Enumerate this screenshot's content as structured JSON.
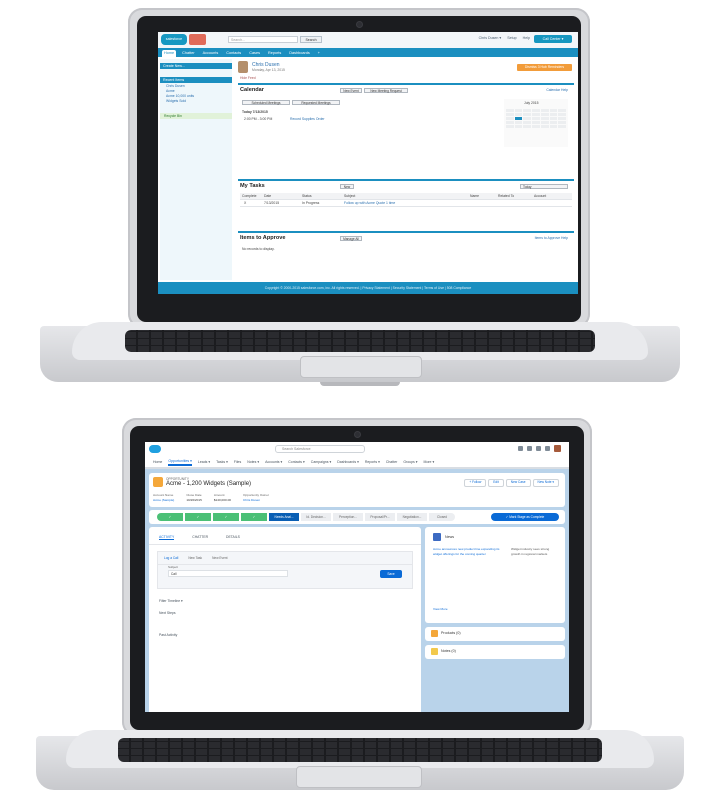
{
  "laptop_top": {
    "screen_app": "classic",
    "header": {
      "logo_text": "salesforce",
      "search_placeholder": "Search...",
      "search_button": "Search",
      "user_menu": "Chris Dusen ▾",
      "help_link": "Setup",
      "help_link_2": "Help",
      "app_switcher": "Call Center ▾"
    },
    "tabs": [
      "Home",
      "Chatter",
      "Accounts",
      "Contacts",
      "Cases",
      "Reports",
      "Dashboards",
      "+"
    ],
    "sidebar": {
      "create_new": "Create New...",
      "recent_items_title": "Recent Items",
      "recent_items": [
        "Chris Dusen",
        "Acme",
        "Acme 10,000 units",
        "Widgets Sold"
      ],
      "recycle_bin": "Recycle Bin"
    },
    "main": {
      "user_name": "Chris Dusen",
      "date": "Monday, Apr 13, 2015",
      "hide_feed": "Hide Feed",
      "orange_button": "Dismiss 3 Hub Reminders",
      "calendar_title": "Calendar",
      "calendar_new_event": "New Event",
      "calendar_new_meeting": "New Meeting Request",
      "calendar_link": "Calendar Help",
      "scheduled_meetings": "Scheduled Meetings",
      "requested_meetings": "Requested Meetings",
      "today_label": "Today 7/13/2015",
      "event_time": "2:00 PM - 3:00 PM",
      "event_link": "Record Supplies Order",
      "month_label": "July 2015",
      "tasks_title": "My Tasks",
      "tasks_new": "New",
      "tasks_filter": "Today",
      "tasks_columns": [
        "Complete",
        "Date",
        "Status",
        "Subject",
        "Name",
        "Related To",
        "Account"
      ],
      "tasks_row": [
        "X",
        "7/13/2015",
        "In Progress",
        "Follow up with Acme Quote 1 time",
        "",
        "",
        ""
      ],
      "approve_title": "Items to Approve",
      "approve_manage": "Manage All",
      "approve_link": "Items to Approve Help",
      "approve_empty": "No records to display.",
      "footer": "Copyright © 2000-2015 salesforce.com, inc. All rights reserved. | Privacy Statement | Security Statement | Terms of Use | 508 Compliance"
    }
  },
  "laptop_bottom": {
    "screen_app": "lightning",
    "header": {
      "search_placeholder": "Search Salesforce"
    },
    "nav": [
      "Home",
      "Opportunities ▾",
      "Leads ▾",
      "Tasks ▾",
      "Files",
      "Notes ▾",
      "Accounts ▾",
      "Contacts ▾",
      "Campaigns ▾",
      "Dashboards ▾",
      "Reports ▾",
      "Chatter",
      "Groups ▾",
      "More ▾"
    ],
    "record": {
      "type_label": "OPPORTUNITY",
      "name": "Acme - 1,200 Widgets (Sample)",
      "buttons": [
        "+ Follow",
        "Edit",
        "New Case",
        "New Note ▾"
      ],
      "fields": [
        {
          "label": "Account Name",
          "value": "Acme (Sample)"
        },
        {
          "label": "Close Date",
          "value": "10/26/2015"
        },
        {
          "label": "Amount",
          "value": "$140,000.00"
        },
        {
          "label": "Opportunity Owner",
          "value": "Chris Dusen"
        }
      ]
    },
    "path": {
      "steps": [
        "✓",
        "✓",
        "✓",
        "✓",
        "Needs Anal...",
        "Id. Decision...",
        "Perception...",
        "Proposal/Pr...",
        "Negotiation...",
        "Closed"
      ],
      "mark_button": "✓ Mark Stage as Complete"
    },
    "tabs": [
      "ACTIVITY",
      "CHATTER",
      "DETAILS"
    ],
    "composer": {
      "tabs": [
        "Log a Call",
        "New Task",
        "New Event"
      ],
      "subject_label": "Subject",
      "subject_value": "Call",
      "share_button": "Save"
    },
    "rows": [
      "Filter Timeline ▾",
      "Next Steps",
      "Past Activity"
    ],
    "news": {
      "title": "News",
      "text_left": "Acme announces new product line expanding its widget offerings for the coming quarter",
      "text_right": "Widget industry sees strong growth in regional markets",
      "more": "View More"
    },
    "cards": [
      {
        "title": "Products (0)",
        "color": "#f4a73a"
      },
      {
        "title": "Notes (0)",
        "color": "#f2c94c"
      }
    ]
  },
  "colors": {
    "classic_blue": "#1b8fc0",
    "lightning_blue": "#0a6ad6",
    "path_green": "#4bc076",
    "lightning_bg": "#b9d3ea",
    "laptop_silver": "#d9dadd"
  }
}
